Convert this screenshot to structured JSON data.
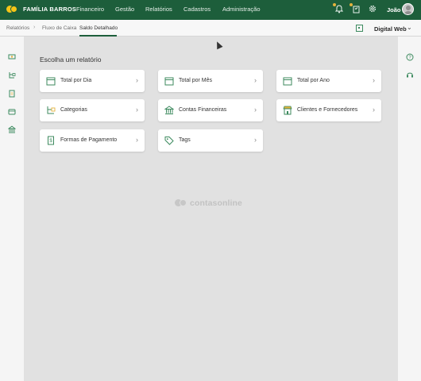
{
  "header": {
    "brand": "FAMÍLIA BARROS",
    "nav": [
      "Financeiro",
      "Gestão",
      "Relatórios",
      "Cadastros",
      "Administração"
    ],
    "user": "João",
    "icons": [
      "bell-icon",
      "tasks-icon",
      "gear-icon"
    ]
  },
  "breadcrumb": {
    "items": [
      "Relatórios",
      "Fluxo de Caixa",
      "Saldo Detalhado"
    ],
    "company": "Digital Web"
  },
  "main": {
    "title": "Escolha um relatório",
    "reports": [
      {
        "label": "Total por Dia",
        "icon": "calendar-icon"
      },
      {
        "label": "Total por Mês",
        "icon": "calendar-icon"
      },
      {
        "label": "Total por Ano",
        "icon": "calendar-icon"
      },
      {
        "label": "Categorias",
        "icon": "category-tree-icon"
      },
      {
        "label": "Contas Financeiras",
        "icon": "bank-icon"
      },
      {
        "label": "Clientes e Fornecedores",
        "icon": "store-icon"
      },
      {
        "label": "Formas de Pagamento",
        "icon": "receipt-icon"
      },
      {
        "label": "Tags",
        "icon": "tag-icon"
      }
    ],
    "watermark": "contasonline"
  },
  "colors": {
    "header_bg": "#1d5e3b",
    "accent": "#3c8a5e",
    "logo": "#f5c518"
  }
}
